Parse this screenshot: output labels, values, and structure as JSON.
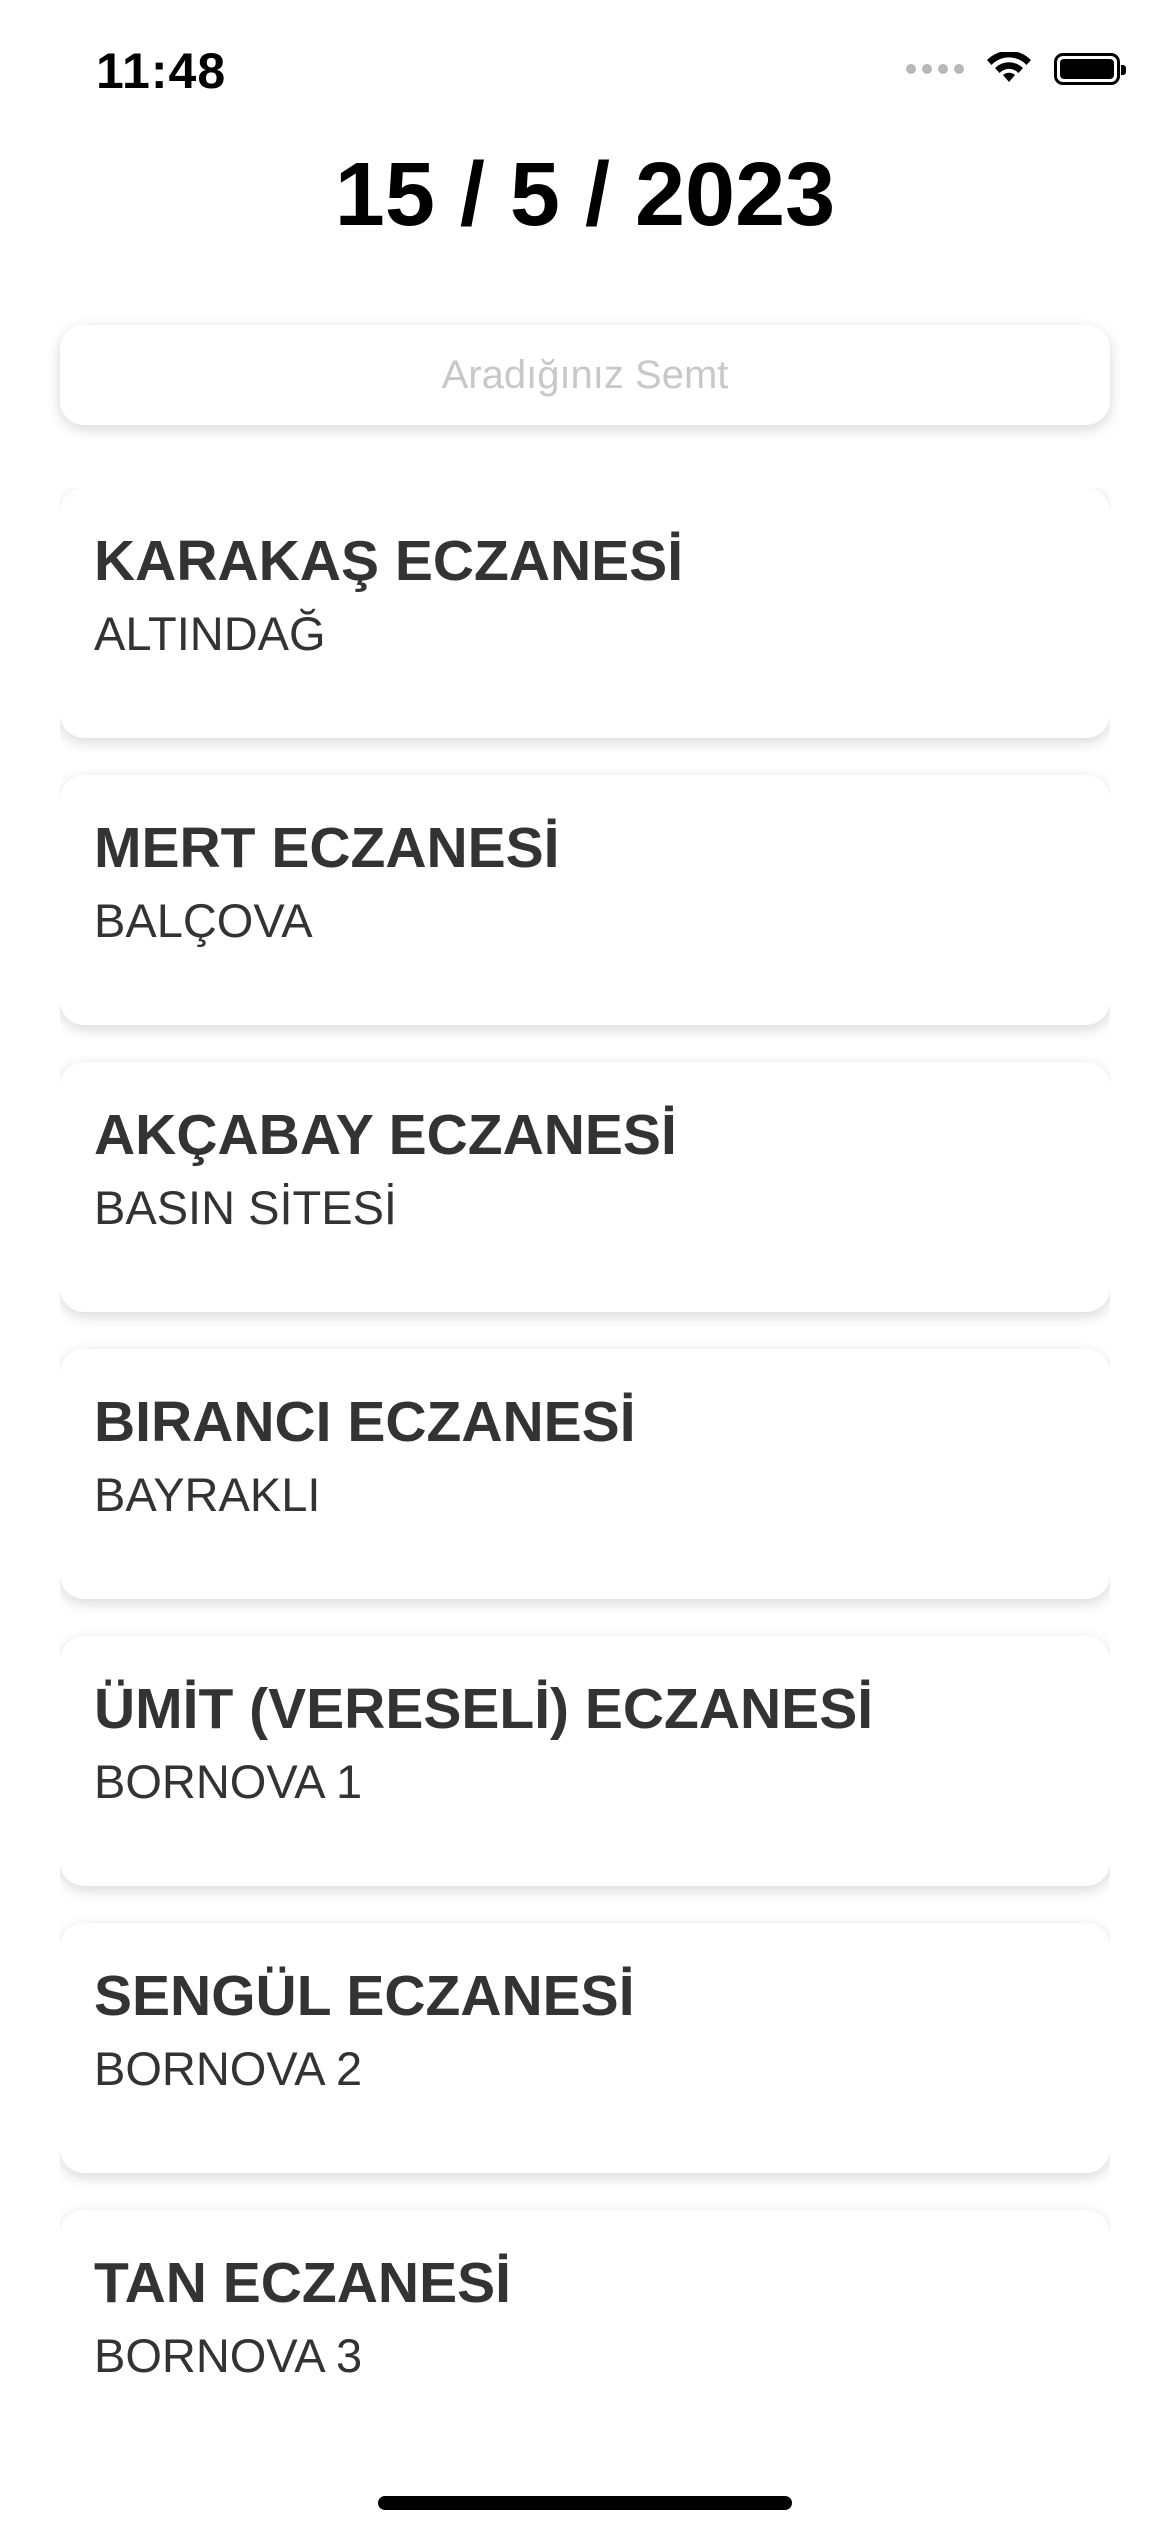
{
  "status_bar": {
    "time": "11:48",
    "icons": [
      "cellular-signal-icon",
      "wifi-icon",
      "battery-icon"
    ]
  },
  "header": {
    "date": "15 / 5 / 2023"
  },
  "search": {
    "placeholder": "Aradığınız Semt",
    "value": ""
  },
  "pharmacies": [
    {
      "name": "KARAKAŞ ECZANESİ",
      "district": "ALTINDAĞ"
    },
    {
      "name": "MERT ECZANESİ",
      "district": "BALÇOVA"
    },
    {
      "name": "AKÇABAY ECZANESİ",
      "district": "BASIN SİTESİ"
    },
    {
      "name": "BIRANCI ECZANESİ",
      "district": "BAYRAKLI"
    },
    {
      "name": "ÜMİT (VERESELİ) ECZANESİ",
      "district": "BORNOVA 1"
    },
    {
      "name": "SENGÜL ECZANESİ",
      "district": "BORNOVA 2"
    },
    {
      "name": "TAN ECZANESİ",
      "district": "BORNOVA 3"
    }
  ],
  "colors": {
    "text": "#333333",
    "placeholder": "#c8c8c8",
    "background": "#ffffff"
  }
}
